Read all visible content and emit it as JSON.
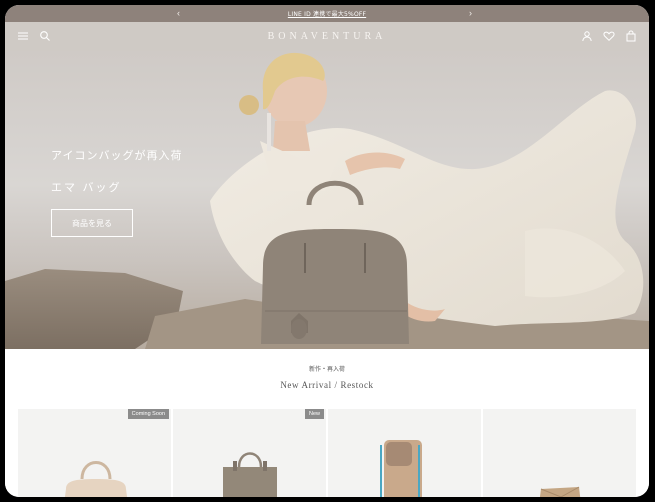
{
  "announcement": {
    "text": "LINE ID 連携で最大5%OFF",
    "prev_arrow": "‹",
    "next_arrow": "›"
  },
  "header": {
    "brand": "BONAVENTURA",
    "icons": [
      "menu-icon",
      "search-icon",
      "account-icon",
      "heart-icon",
      "bag-icon"
    ]
  },
  "hero": {
    "headline": "アイコンバッグが再入荷",
    "subheadline": "エマ バッグ",
    "cta_label": "商品を見る"
  },
  "section": {
    "title_ja": "新作・再入荷",
    "title_en": "New Arrival / Restock",
    "products": [
      {
        "badge": "Coming Soon"
      },
      {
        "badge": "New"
      },
      {
        "badge": ""
      },
      {
        "badge": ""
      }
    ]
  },
  "colors": {
    "announce_bg": "#8e827b",
    "bag_color": "#8f8478",
    "card_bg": "#f3f3f2",
    "badge_bg": "#8b8b8b"
  }
}
